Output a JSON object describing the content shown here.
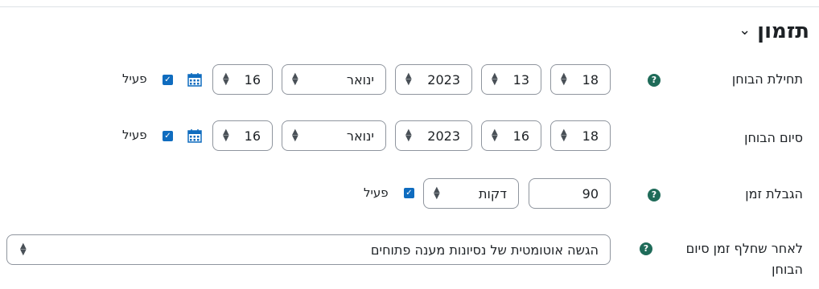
{
  "section": {
    "title": "תזמון"
  },
  "rows": [
    {
      "label": "תחילת הבוחן",
      "day": "18",
      "hour": "13",
      "year": "2023",
      "month": "ינואר",
      "minute": "16",
      "enabled_label": "פעיל"
    },
    {
      "label": "סיום הבוחן",
      "day": "18",
      "hour": "16",
      "year": "2023",
      "month": "ינואר",
      "minute": "16",
      "enabled_label": "פעיל"
    }
  ],
  "time_limit": {
    "label": "הגבלת זמן",
    "value": "90",
    "unit": "דקות",
    "enabled_label": "פעיל"
  },
  "after_close": {
    "label_line1": "לאחר שחלף זמן סיום",
    "label_line2": "הבוחן",
    "value": "הגשה אוטומטית של נסיונות מענה פתוחים"
  },
  "colors": {
    "help": "#1f6b59",
    "checkbox": "#0f6cbf",
    "border": "#8f959e"
  }
}
